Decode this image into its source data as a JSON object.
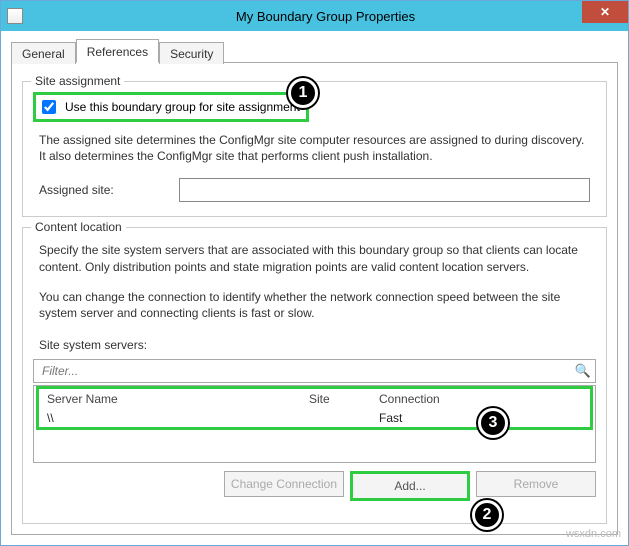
{
  "window": {
    "title": "My Boundary Group Properties"
  },
  "tabs": {
    "general": "General",
    "references": "References",
    "security": "Security"
  },
  "siteAssignment": {
    "title": "Site assignment",
    "checkboxLabel": "Use this boundary group for site assignment",
    "description": "The assigned site determines the ConfigMgr site computer resources are assigned to during discovery. It also determines the ConfigMgr site that performs client push installation.",
    "assignedSiteLabel": "Assigned site:",
    "assignedSiteValue": ""
  },
  "contentLocation": {
    "title": "Content location",
    "desc1": "Specify the site system servers that are associated with this boundary group so that clients can locate content. Only distribution points and state migration points are valid content location servers.",
    "desc2": "You can change the connection to identify whether the network connection speed between the site system server and connecting clients is fast or slow.",
    "listLabel": "Site system servers:",
    "filterPlaceholder": "Filter...",
    "columns": {
      "name": "Server Name",
      "site": "Site",
      "conn": "Connection"
    },
    "rows": [
      {
        "name": "\\\\",
        "site": "",
        "conn": "Fast"
      }
    ],
    "buttons": {
      "change": "Change Connection",
      "add": "Add...",
      "remove": "Remove"
    }
  },
  "callouts": {
    "one": "1",
    "two": "2",
    "three": "3"
  },
  "watermark": "wsxdn.com"
}
